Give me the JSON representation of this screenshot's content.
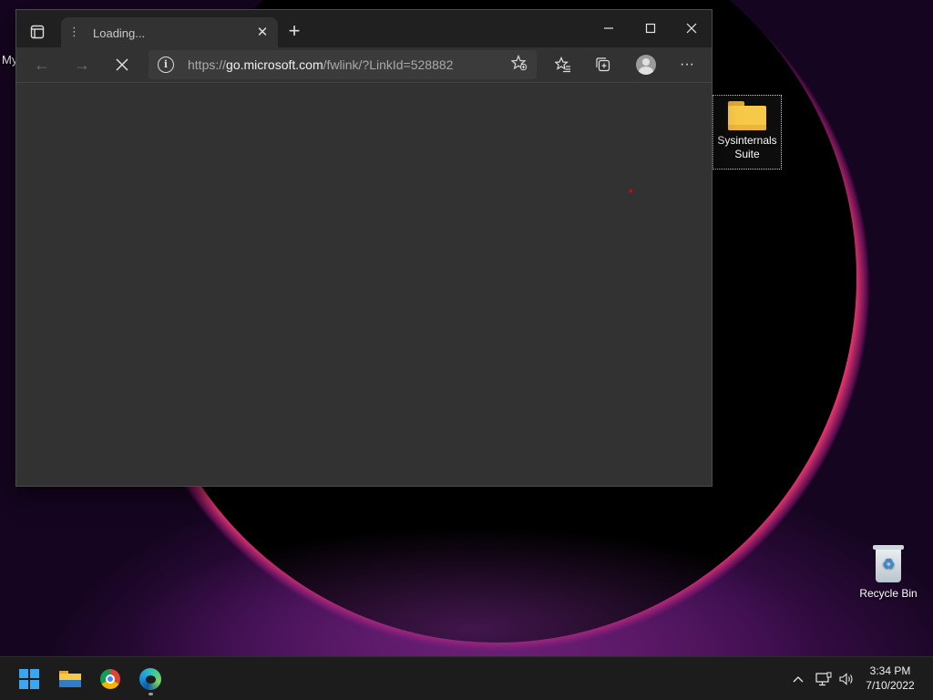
{
  "desktop": {
    "partial_label": "My",
    "icons": [
      {
        "label": "Sysinternals\nSuite",
        "line1": "Sysinternals",
        "line2": "Suite"
      },
      {
        "label": "Recycle Bin"
      }
    ]
  },
  "browser": {
    "tab": {
      "title": "Loading..."
    },
    "address": {
      "scheme": "https://",
      "host": "go.microsoft.com",
      "path": "/fwlink/?LinkId=528882"
    },
    "icons": {
      "tab_actions": "tab-actions-icon",
      "back": "back-arrow-icon",
      "forward": "forward-arrow-icon",
      "stop": "stop-icon",
      "info": "info-icon",
      "favorite_add": "add-favorite-icon",
      "favorites": "favorites-icon",
      "collections": "collections-icon",
      "profile": "profile-icon",
      "menu": "more-icon"
    },
    "glyphs": {
      "info": "i",
      "new_tab": "+",
      "close_tab": "✕",
      "minimize": "—",
      "maximize": "☐",
      "close": "✕",
      "back": "←",
      "forward": "→",
      "stop": "✕",
      "favorite_add": "☆",
      "favorites": "☆",
      "collections": "⧉",
      "menu": "···"
    }
  },
  "taskbar": {
    "apps": [
      "start-icon",
      "file-explorer-icon",
      "chrome-icon",
      "edge-icon"
    ],
    "tray": {
      "chevron": "^",
      "network": "▭",
      "volume": "🔈"
    },
    "clock": {
      "time": "3:34 PM",
      "date": "7/10/2022"
    }
  },
  "colors": {
    "window_bg": "#323232",
    "tabstrip_bg": "#202020",
    "taskbar_bg": "#1c1c1c",
    "accent_blue": "#3aa6f2"
  }
}
